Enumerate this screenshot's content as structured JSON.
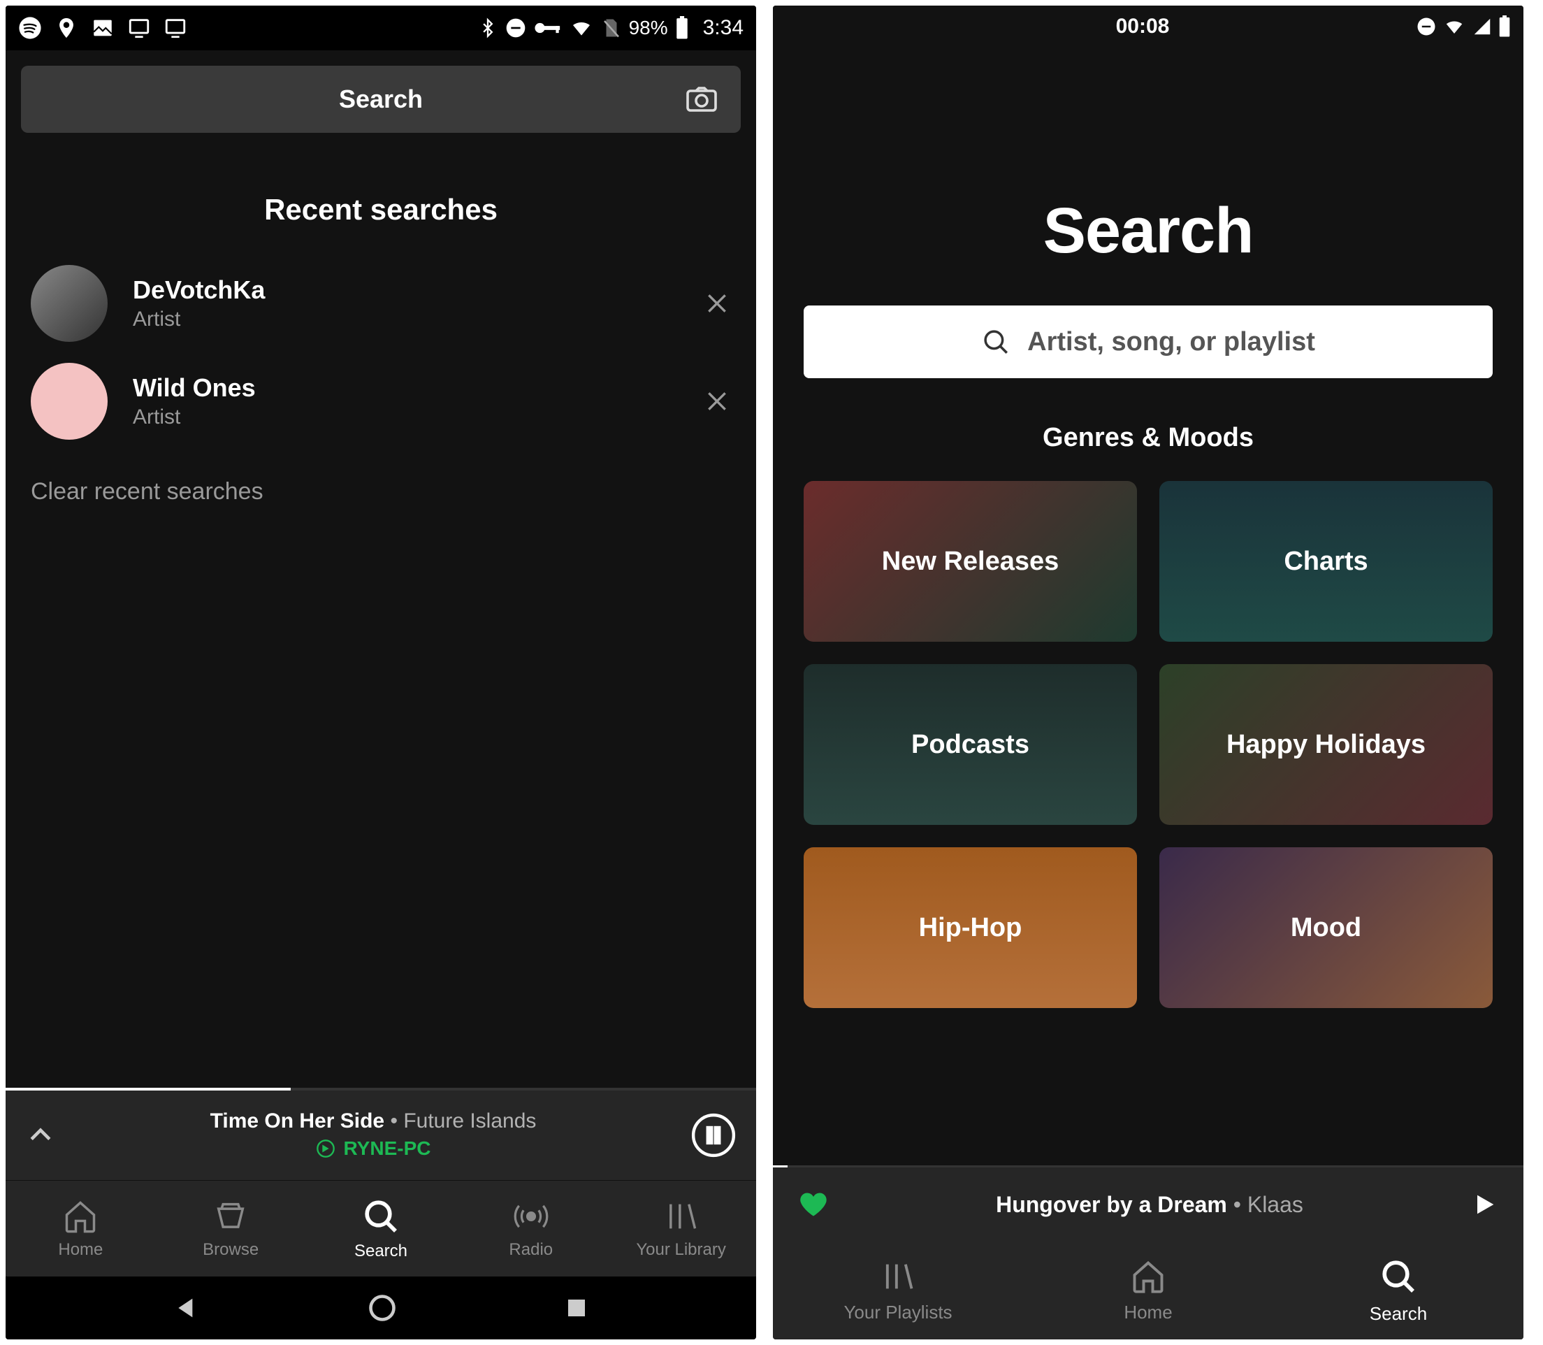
{
  "left": {
    "status": {
      "battery": "98%",
      "time": "3:34"
    },
    "search_bar": {
      "label": "Search"
    },
    "recent_heading": "Recent searches",
    "recent": [
      {
        "title": "DeVotchKa",
        "subtitle": "Artist"
      },
      {
        "title": "Wild Ones",
        "subtitle": "Artist"
      }
    ],
    "clear_label": "Clear recent searches",
    "now_playing": {
      "song": "Time On Her Side",
      "separator": "•",
      "artist": "Future Islands",
      "device": "RYNE-PC"
    },
    "nav": {
      "home": "Home",
      "browse": "Browse",
      "search": "Search",
      "radio": "Radio",
      "library": "Your Library"
    }
  },
  "right": {
    "status": {
      "time": "00:08"
    },
    "hero_title": "Search",
    "search_placeholder": "Artist, song, or playlist",
    "genres_heading": "Genres & Moods",
    "tiles": [
      "New Releases",
      "Charts",
      "Podcasts",
      "Happy Holidays",
      "Hip-Hop",
      "Mood"
    ],
    "now_playing": {
      "song": "Hungover by a Dream",
      "separator": "•",
      "artist": "Klaas"
    },
    "nav": {
      "playlists": "Your Playlists",
      "home": "Home",
      "search": "Search"
    }
  }
}
